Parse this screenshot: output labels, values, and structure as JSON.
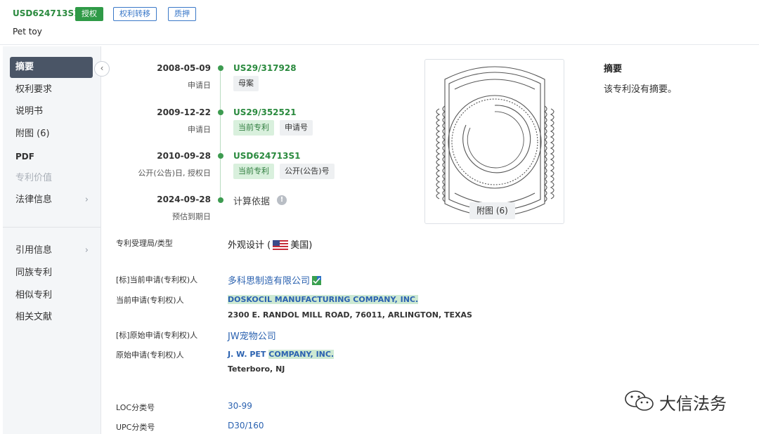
{
  "header": {
    "patent_number": "USD624713S1",
    "status_badge": "授权",
    "transfer_badge": "权利转移",
    "pledge_badge": "质押",
    "title": "Pet toy"
  },
  "sidebar": {
    "items": [
      "摘要",
      "权利要求",
      "说明书",
      "附图 (6)",
      "PDF",
      "专利价值",
      "法律信息"
    ],
    "items2": [
      "引用信息",
      "同族专利",
      "相似专利",
      "相关文献"
    ],
    "collapse_glyph": "‹",
    "chevron_glyph": "›"
  },
  "timeline": [
    {
      "date": "2008-05-09",
      "sub": "申请日",
      "number": "US29/317928",
      "tags": [
        "母案"
      ]
    },
    {
      "date": "2009-12-22",
      "sub": "申请日",
      "number": "US29/352521",
      "tags": [
        "当前专利",
        "申请号"
      ]
    },
    {
      "date": "2010-09-28",
      "sub": "公开(公告)日, 授权日",
      "number": "USD624713S1",
      "tags": [
        "当前专利",
        "公开(公告)号"
      ]
    },
    {
      "date": "2024-09-28",
      "sub": "预估到期日",
      "calc_label": "计算依据",
      "info_glyph": "!"
    }
  ],
  "figure": {
    "label": "附图 (6)"
  },
  "abstract": {
    "heading": "摘要",
    "text": "该专利没有摘要。"
  },
  "fields": {
    "office_label": "专利受理局/类型",
    "office_value_pre": "外观设计 (",
    "office_country": "美国)",
    "std_current_label": "[标]当前申请(专利权)人",
    "std_current_value": "多科思制造有限公司",
    "current_label": "当前申请(专利权)人",
    "current_name_a": "DOSKOCIL MANUFACTURING",
    "current_name_b": " COMPANY,",
    "current_name_c": " INC.",
    "current_address": "2300 E. RANDOL MILL ROAD, 76011, ARLINGTON, TEXAS",
    "std_original_label": "[标]原始申请(专利权)人",
    "std_original_value": "JW宠物公司",
    "original_label": "原始申请(专利权)人",
    "original_name_a": "J. W. PET ",
    "original_name_b": "COMPANY,",
    "original_name_c": " INC.",
    "original_address": "Teterboro, NJ",
    "loc_label": "LOC分类号",
    "loc_value": "30-99",
    "upc_label": "UPC分类号",
    "upc_value": "D30/160"
  },
  "watermark": {
    "text": "大信法务"
  },
  "colors": {
    "brand_green": "#2f9a47",
    "link_blue": "#2b62b0",
    "highlight": "#cde9d2",
    "nav_active": "#4a5566"
  }
}
